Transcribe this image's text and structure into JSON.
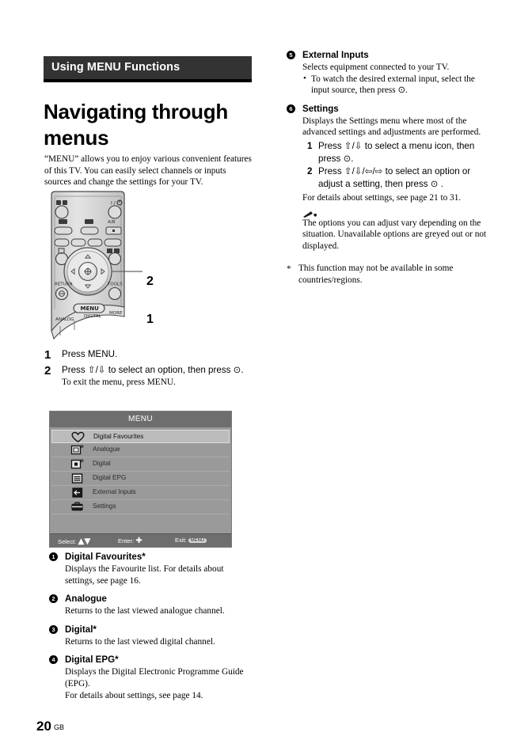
{
  "banner": {
    "label": "Using MENU Functions"
  },
  "title": "Navigating through menus",
  "intro": "“MENU” allows you to enjoy various convenient features of this TV. You can easily select channels or inputs sources and change the settings for your TV.",
  "illustration": {
    "remote": {
      "name": "tv-remote-control",
      "callout_2": "2",
      "callout_1": "1",
      "buttons": [
        "RETURN",
        "TOOLS",
        "MENU",
        "A/B",
        "ANALOG",
        "DIGITAL",
        "MORE"
      ]
    }
  },
  "steps": [
    {
      "num": "1",
      "text": "Press MENU.",
      "sub": ""
    },
    {
      "num": "2",
      "text": "Press ⇧/⇩ to select an option, then press ⊙.",
      "sub": "To exit the menu, press MENU."
    }
  ],
  "osd": {
    "title": "MENU",
    "rows": [
      {
        "icon": "heart-icon",
        "label": "Digital Favourites",
        "selected": true
      },
      {
        "icon": "analogue-tv-icon",
        "label": "Analogue",
        "selected": false
      },
      {
        "icon": "digital-tv-icon",
        "label": "Digital",
        "selected": false
      },
      {
        "icon": "epg-list-icon",
        "label": "Digital EPG",
        "selected": false
      },
      {
        "icon": "external-input-icon",
        "label": "External Inputs",
        "selected": false
      },
      {
        "icon": "toolbox-settings-icon",
        "label": "Settings",
        "selected": false
      }
    ],
    "footer": {
      "select_label": "Select:",
      "enter_label": "Enter:",
      "exit_label": "Exit:",
      "exit_key": "MENU"
    },
    "colors": {
      "background": "#9a9a9a",
      "titlebar": "#6e6e6e",
      "selected_row": "#bcbcbc"
    }
  },
  "legend_left": [
    {
      "num": "1",
      "title": "Digital Favourites*",
      "desc": "Displays the Favourite list. For details about settings, see page 16."
    },
    {
      "num": "2",
      "title": "Analogue",
      "desc": "Returns to the last viewed analogue channel."
    },
    {
      "num": "3",
      "title": "Digital*",
      "desc": "Returns to the last viewed digital channel."
    },
    {
      "num": "4",
      "title": "Digital EPG*",
      "desc": "Displays the Digital Electronic Programme Guide (EPG).\nFor details about settings, see page 14."
    }
  ],
  "legend_right": {
    "external_inputs": {
      "num": "5",
      "title": "External Inputs",
      "desc": "Selects equipment connected to your TV.",
      "bullet": "To watch the desired external input, select the input source, then press ⊙."
    },
    "settings": {
      "num": "6",
      "title": "Settings",
      "desc": "Displays the Settings menu where most of the advanced settings and adjustments are performed.",
      "substeps": [
        {
          "num": "1",
          "text": "Press ⇧/⇩ to select a menu icon, then press ⊙."
        },
        {
          "num": "2",
          "text": "Press ⇧/⇩/⇦/⇨ to select an option or adjust a setting, then press ⊙ ."
        }
      ],
      "details": "For details about settings, see page 21 to 31.",
      "note_icon": "pencil-note-icon",
      "note": "The options you can adjust vary depending on the situation. Unavailable options are greyed out or not displayed."
    }
  },
  "footnote": {
    "marker": "*",
    "text": "This function may not be available in some countries/regions."
  },
  "page": {
    "number": "20",
    "region": "GB"
  }
}
